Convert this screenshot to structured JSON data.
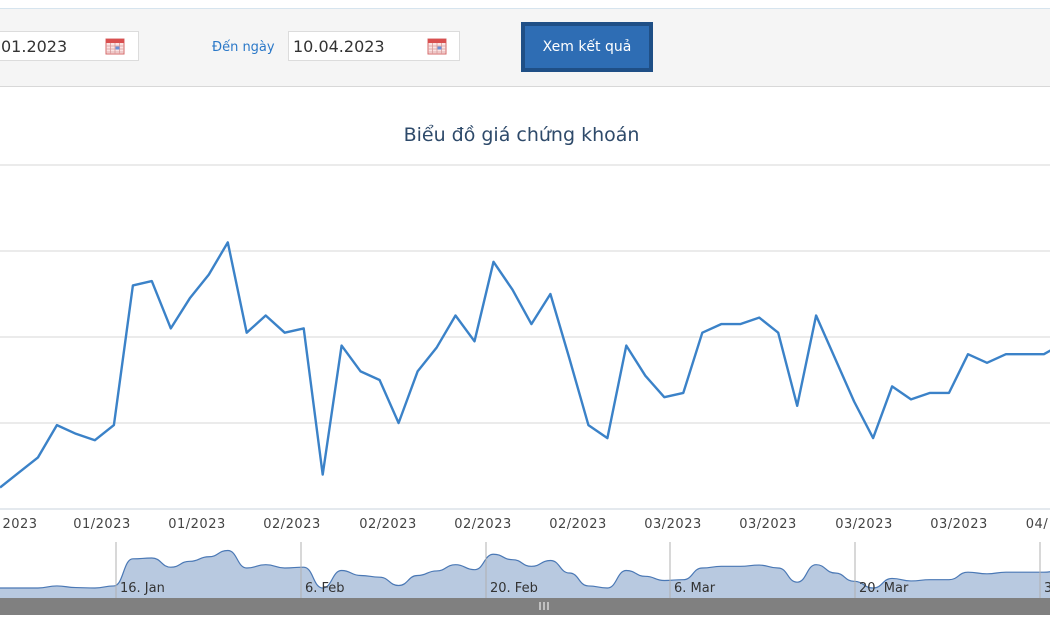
{
  "filter": {
    "from_date": "01.2023",
    "to_label": "Đến ngày",
    "to_date": "10.04.2023",
    "submit_label": "Xem kết quả"
  },
  "chart_data": {
    "type": "line",
    "title": "Biểu đồ giá chứng khoán",
    "xlabel": "",
    "ylabel": "",
    "grid": true,
    "series_color": "#3b82c8",
    "x_tick_labels": [
      "2023",
      "01/2023",
      "01/2023",
      "02/2023",
      "02/2023",
      "02/2023",
      "02/2023",
      "03/2023",
      "03/2023",
      "03/2023",
      "03/2023",
      "04/"
    ],
    "values": [
      0.5,
      0.85,
      1.2,
      1.95,
      1.75,
      1.6,
      1.95,
      5.2,
      5.3,
      4.2,
      4.9,
      5.45,
      6.2,
      4.1,
      4.5,
      4.1,
      4.2,
      0.8,
      3.8,
      3.2,
      3.0,
      2.0,
      3.2,
      3.75,
      4.5,
      3.9,
      5.75,
      5.1,
      4.3,
      5.0,
      3.5,
      1.95,
      1.65,
      3.8,
      3.1,
      2.6,
      2.7,
      4.1,
      4.3,
      4.3,
      4.45,
      4.1,
      2.4,
      4.5,
      3.5,
      2.5,
      1.65,
      2.85,
      2.55,
      2.7,
      2.7,
      3.6,
      3.4,
      3.6,
      3.6,
      3.6,
      3.85
    ],
    "navigator": {
      "labels": [
        "16. Jan",
        "6. Feb",
        "20. Feb",
        "6. Mar",
        "20. Mar",
        "3"
      ],
      "fill": "#b8c9e0",
      "line": "#4a78b5"
    }
  }
}
